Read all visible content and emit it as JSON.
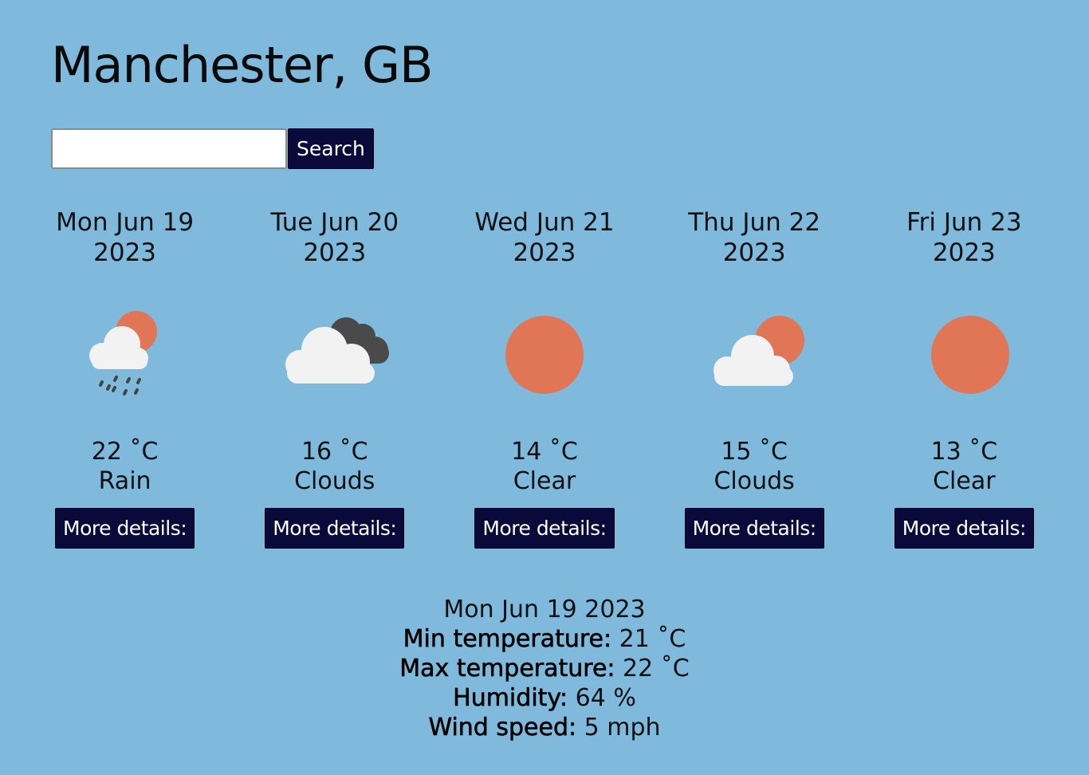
{
  "header": {
    "city": "Manchester, GB"
  },
  "search": {
    "value": "",
    "placeholder": "",
    "button_label": "Search"
  },
  "forecast": [
    {
      "date_line1": "Mon Jun 19",
      "date_line2": "2023",
      "icon": "rain-sun-icon",
      "temp": "22 ˚C",
      "desc": "Rain",
      "button_label": "More details:"
    },
    {
      "date_line1": "Tue Jun 20",
      "date_line2": "2023",
      "icon": "clouds-icon",
      "temp": "16 ˚C",
      "desc": "Clouds",
      "button_label": "More details:"
    },
    {
      "date_line1": "Wed Jun 21",
      "date_line2": "2023",
      "icon": "sun-icon",
      "temp": "14 ˚C",
      "desc": "Clear",
      "button_label": "More details:"
    },
    {
      "date_line1": "Thu Jun 22",
      "date_line2": "2023",
      "icon": "partly-cloudy-icon",
      "temp": "15 ˚C",
      "desc": "Clouds",
      "button_label": "More details:"
    },
    {
      "date_line1": "Fri Jun 23",
      "date_line2": "2023",
      "icon": "sun-icon",
      "temp": "13 ˚C",
      "desc": "Clear",
      "button_label": "More details:"
    }
  ],
  "details": {
    "date": "Mon Jun 19 2023",
    "min_label": "Min temperature:",
    "min_value": " 21 ˚C",
    "max_label": "Max temperature:",
    "max_value": " 22 ˚C",
    "humidity_label": "Humidity:",
    "humidity_value": " 64 %",
    "wind_label": "Wind speed:",
    "wind_value": " 5 mph"
  },
  "colors": {
    "background": "#7fbadd",
    "button_bg": "#0a0a3a",
    "sun": "#e07656",
    "cloud_light": "#f2f2f2",
    "cloud_dark": "#4a4a4a"
  }
}
